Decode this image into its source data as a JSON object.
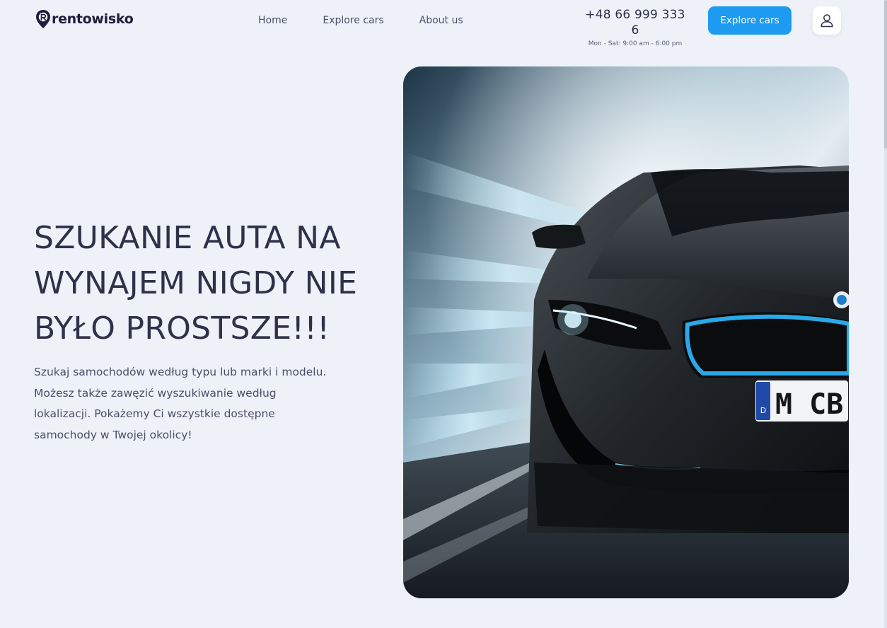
{
  "brand": {
    "name": "rentowisko"
  },
  "nav": {
    "items": [
      {
        "label": "Home"
      },
      {
        "label": "Explore cars"
      },
      {
        "label": "About us"
      }
    ]
  },
  "contact": {
    "phone": "+48 66 999 333 6",
    "hours": "Mon - Sat: 9:00 am - 6:00 pm"
  },
  "header": {
    "cta_label": "Explore cars",
    "user_icon": "user-icon"
  },
  "hero": {
    "title_lines": [
      "SZUKANIE AUTA NA",
      "WYNAJEM NIGDY NIE",
      "BYŁO PROSTSZE!!!"
    ],
    "description_lines": [
      "Szukaj samochodów według typu lub marki i modelu.",
      "Możesz także zawęzić wyszukiwanie według",
      "lokalizacji. Pokażemy Ci wszystkie dostępne",
      "samochody w Twojej okolicy!"
    ],
    "image": {
      "plate_country": "D",
      "plate_text": "M CB"
    }
  },
  "colors": {
    "background": "#eef1f8",
    "accent": "#1d9bf0",
    "text_dark": "#2f3149",
    "text_muted": "#4a4f66"
  }
}
